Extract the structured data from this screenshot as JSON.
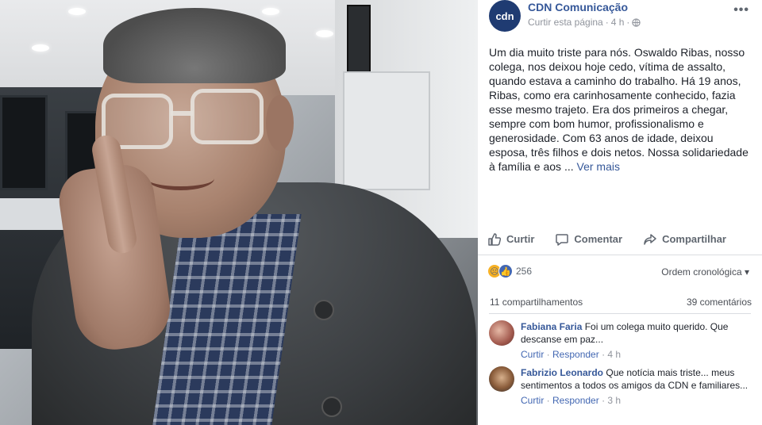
{
  "post": {
    "page_name": "CDN Comunicação",
    "avatar_text": "cdn",
    "like_page": "Curtir esta página",
    "time": "4 h",
    "text": "Um dia muito triste para nós. Oswaldo Ribas, nosso colega, nos deixou hoje cedo, vítima de assalto, quando estava a caminho do trabalho. Há 19 anos, Ribas, como era carinhosamente conhecido, fazia esse mesmo trajeto. Era dos primeiros a chegar, sempre com bom humor, profissionalismo e generosidade. Com 63 anos de idade, deixou esposa, três filhos e dois netos. Nossa solidariedade à família e aos ...",
    "see_more": "Ver mais"
  },
  "actions": {
    "like": "Curtir",
    "comment": "Comentar",
    "share": "Compartilhar"
  },
  "reactions": {
    "count": "256",
    "order_label": "Ordem cronológica"
  },
  "stats": {
    "shares": "11 compartilhamentos",
    "comments": "39 comentários"
  },
  "comments": [
    {
      "name": "Fabiana Faria",
      "text": "Foi um colega muito querido. Que descanse em paz...",
      "like": "Curtir",
      "reply": "Responder",
      "time": "4 h"
    },
    {
      "name": "Fabrizio Leonardo",
      "text": "Que notícia mais triste... meus sentimentos a todos os amigos da CDN e familiares...",
      "like": "Curtir",
      "reply": "Responder",
      "time": "3 h"
    }
  ],
  "colors": {
    "link": "#365899",
    "muted": "#90949c",
    "like_blue": "#4267b2"
  }
}
